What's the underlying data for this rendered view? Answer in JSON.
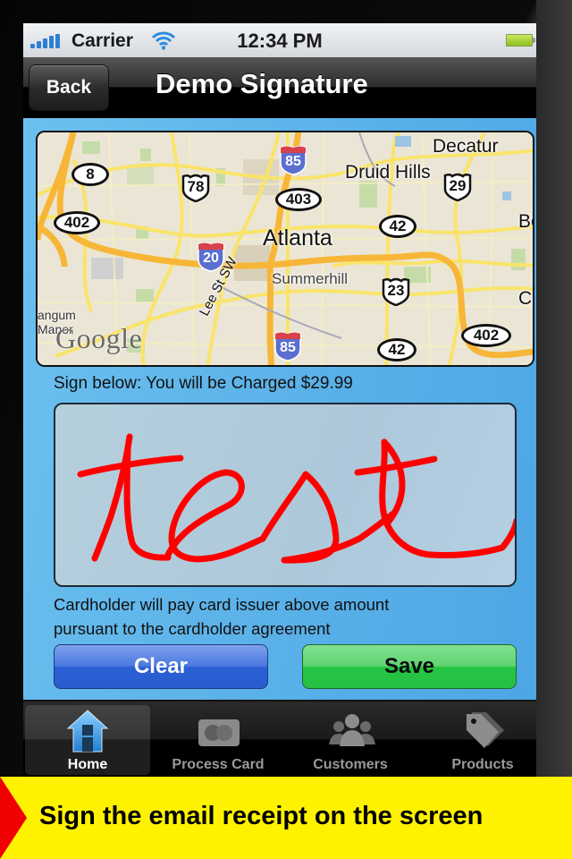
{
  "status_bar": {
    "carrier": "Carrier",
    "time": "12:34 PM",
    "signal_icon": "signal-bars-icon",
    "wifi_icon": "wifi-icon",
    "battery_icon": "battery-icon"
  },
  "nav_bar": {
    "back_label": "Back",
    "title": "Demo Signature"
  },
  "map": {
    "labels": {
      "decatur": "Decatur",
      "druid_hills": "Druid Hills",
      "atlanta": "Atlanta",
      "summerhill": "Summerhill",
      "lee_st": "Lee St SW",
      "belvedere": "Bel",
      "candler": "Ca",
      "mangum": "angum",
      "manor": "Manor"
    },
    "routes": {
      "r8": "8",
      "r78": "78",
      "r85_top": "85",
      "r403": "403",
      "r29": "29",
      "r402_left": "402",
      "r42_top": "42",
      "r20": "20",
      "r23": "23",
      "r85_bottom": "85",
      "r42_bottom": "42",
      "r402_right": "402"
    },
    "attribution": "Google"
  },
  "signature": {
    "prompt": "Sign below:  You will be Charged $29.99",
    "amount": "$29.99",
    "ink_color": "#ff0000",
    "handwritten_text": "test"
  },
  "disclaimer": {
    "line1": "Cardholder will pay card issuer above amount",
    "line2": "pursuant to the cardholder agreement"
  },
  "buttons": {
    "clear": "Clear",
    "save": "Save"
  },
  "tab_bar": {
    "items": [
      {
        "label": "Home",
        "icon": "home-icon",
        "active": true
      },
      {
        "label": "Process Card",
        "icon": "credit-card-icon",
        "active": false
      },
      {
        "label": "Customers",
        "icon": "customers-icon",
        "active": false
      },
      {
        "label": "Products",
        "icon": "price-tag-icon",
        "active": false
      }
    ]
  },
  "banner": {
    "text": "Sign the email receipt on the screen"
  },
  "colors": {
    "clear_button": "#2b5cd0",
    "save_button": "#26c043",
    "banner_bg": "#fff200",
    "banner_arrow": "#f00000",
    "content_bg": "#5fb5ea"
  }
}
